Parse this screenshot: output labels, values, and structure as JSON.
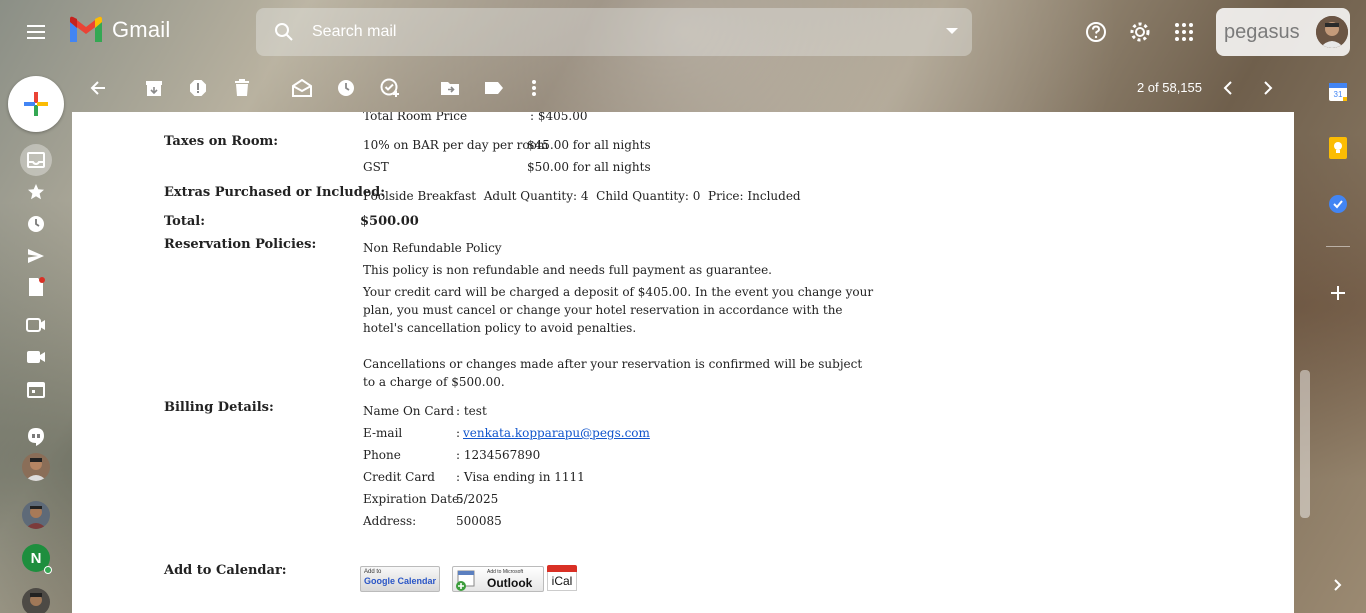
{
  "app": {
    "name": "Gmail",
    "menu_icon": "hamburger-menu-icon"
  },
  "search": {
    "placeholder": "Search mail"
  },
  "account": {
    "brand": "pegasus"
  },
  "toolbar": {
    "pager": "2 of 58,155"
  },
  "email": {
    "room_price_label": "Total Room Price",
    "room_price_value": ": $405.00",
    "taxes_label": "Taxes on Room:",
    "taxes": [
      {
        "name": "10% on BAR per day per room",
        "value": "$45.00 for all nights"
      },
      {
        "name": "GST",
        "value": "$50.00 for all nights"
      }
    ],
    "extras_label": "Extras Purchased or Included:",
    "extras_value": "Poolside Breakfast  Adult Quantity: 4  Child Quantity: 0  Price: Included",
    "total_label": "Total:",
    "total_value": "$500.00",
    "policies_label": "Reservation Policies:",
    "policy_name": "Non Refundable Policy",
    "policy_line1": "This policy is non refundable and needs full payment as guarantee.",
    "policy_para1_l1": "Your credit card will be charged a deposit of $405.00. In the event you change your",
    "policy_para1_l2": "plan, you must cancel or change your hotel reservation in accordance with the",
    "policy_para1_l3": "hotel's cancellation policy to avoid penalties.",
    "policy_para2_l1": "Cancellations or changes made after your reservation is confirmed will be subject",
    "policy_para2_l2": "to a charge of $500.00.",
    "billing_label": "Billing Details:",
    "billing": {
      "name_label": "Name On Card",
      "name_value": ": test",
      "email_label": "E-mail",
      "email_colon": ":",
      "email_value": "venkata.kopparapu@pegs.com",
      "phone_label": "Phone",
      "phone_value": ": 1234567890",
      "card_label": "Credit Card",
      "card_value": ": Visa ending in 1111",
      "exp_label": "Expiration Date:",
      "exp_value": "5/2025",
      "address_label": "Address:",
      "address_value": "500085"
    },
    "calendar_label": "Add to Calendar:",
    "calendar_buttons": {
      "google_small": "Add to",
      "google_big": "Google Calendar",
      "outlook_small": "Add to Microsoft",
      "outlook_big": "Outlook",
      "ical": "iCal"
    }
  },
  "colors": {
    "gmail_red": "#ea4335",
    "link": "#1155cc",
    "notification_dot": "#d93025",
    "status_green": "#1e8e3e"
  },
  "rail": {
    "avatar_letter": "N"
  }
}
